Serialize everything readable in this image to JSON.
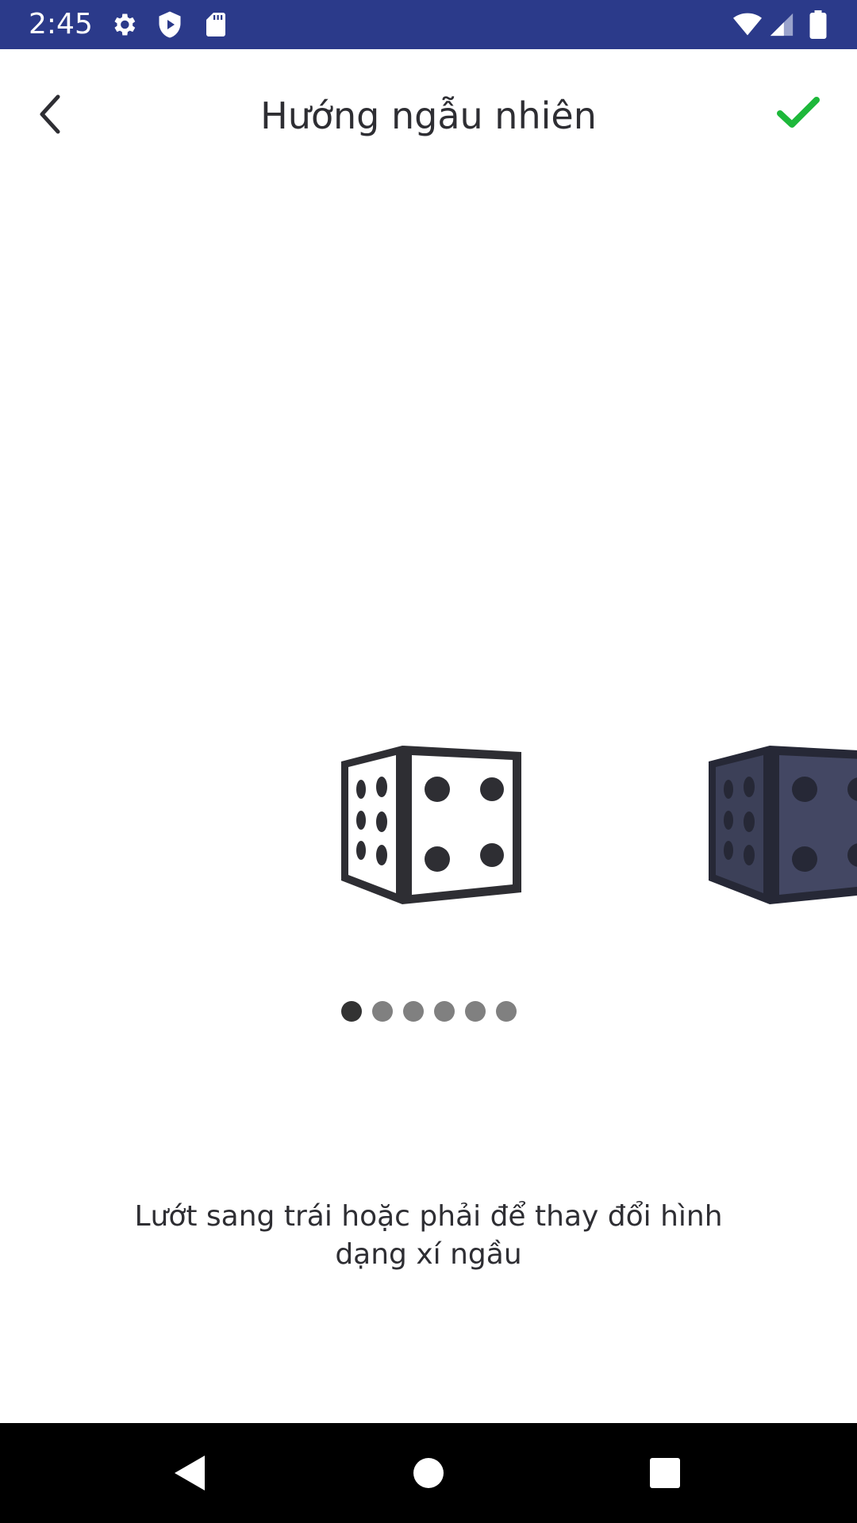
{
  "status_bar": {
    "time": "2:45",
    "background": "#2b3a8a",
    "icons_left": [
      "settings-icon",
      "shield-play-icon",
      "sd-card-icon"
    ],
    "icons_right": [
      "wifi-icon",
      "signal-icon",
      "battery-icon"
    ]
  },
  "header": {
    "title": "Hướng ngẫu nhiên",
    "back_icon": "chevron-left-icon",
    "confirm_icon": "check-icon",
    "confirm_color": "#1db83a"
  },
  "carousel": {
    "items": [
      {
        "name": "die-white",
        "style": "white"
      },
      {
        "name": "die-navy",
        "style": "navy"
      }
    ],
    "page_count": 6,
    "active_page": 1
  },
  "instruction": {
    "text": "Lướt sang trái hoặc phải để thay đổi hình dạng xí ngầu"
  },
  "nav_bar": {
    "buttons": [
      "back-triangle-icon",
      "home-circle-icon",
      "recents-square-icon"
    ]
  }
}
